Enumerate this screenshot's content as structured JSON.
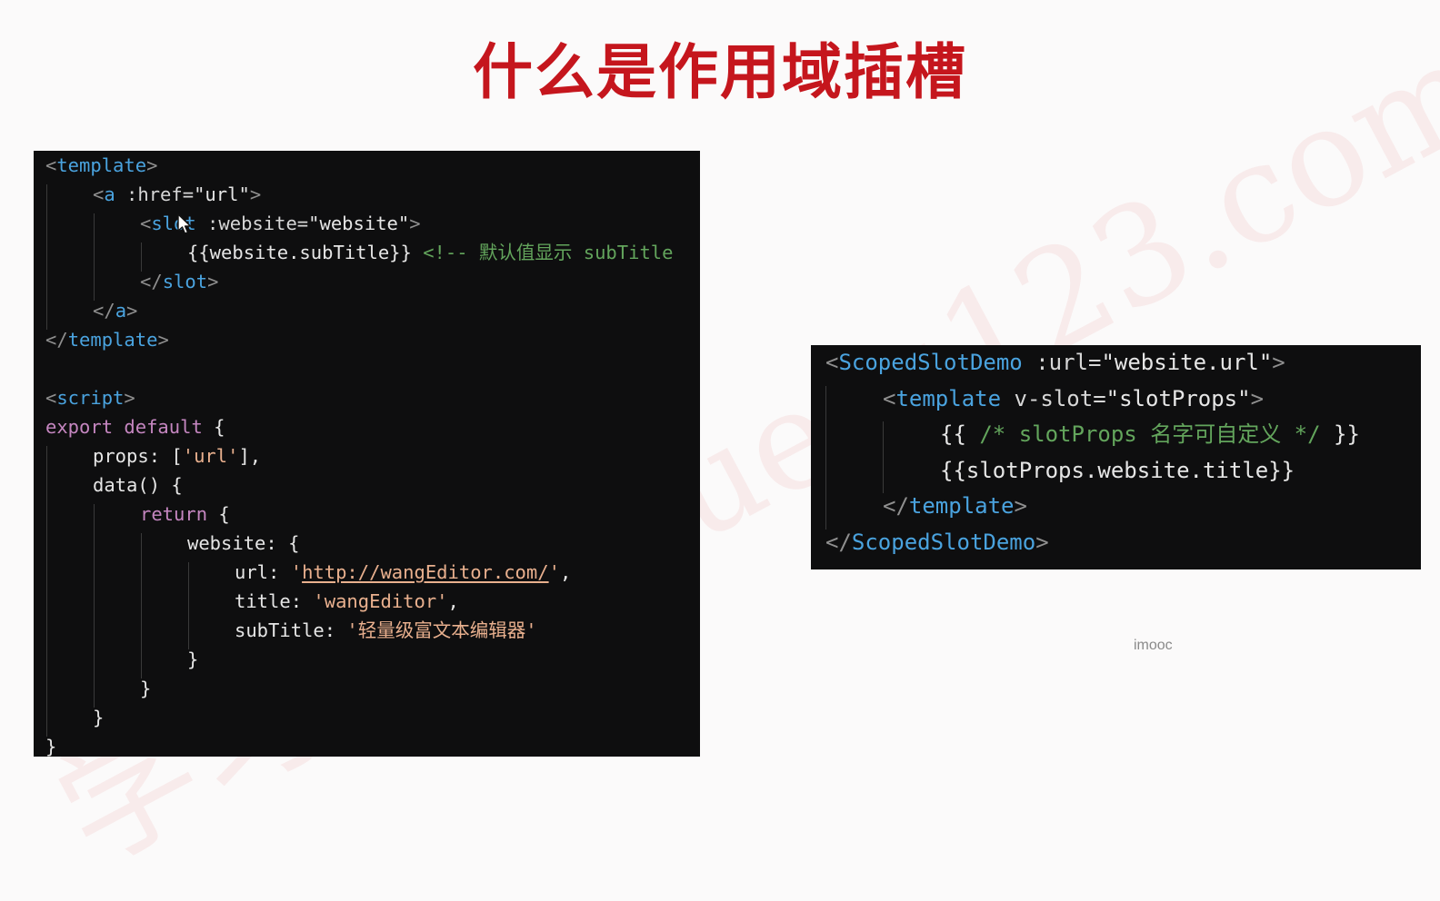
{
  "slide": {
    "title": "什么是作用域插槽",
    "watermark": "学习天优 Xuetu123.com",
    "imooc_label": "imooc"
  },
  "code_left": [
    {
      "indent": 0,
      "tokens": [
        {
          "t": "<",
          "c": "punct"
        },
        {
          "t": "template",
          "c": "tag"
        },
        {
          "t": ">",
          "c": "punct"
        }
      ]
    },
    {
      "indent": 1,
      "tokens": [
        {
          "t": "<",
          "c": "punct"
        },
        {
          "t": "a",
          "c": "tag"
        },
        {
          "t": " :href=",
          "c": "attr"
        },
        {
          "t": "\"url\"",
          "c": "text"
        },
        {
          "t": ">",
          "c": "punct"
        }
      ]
    },
    {
      "indent": 2,
      "tokens": [
        {
          "t": "<",
          "c": "punct"
        },
        {
          "t": "slot",
          "c": "tag"
        },
        {
          "t": " :website=",
          "c": "attr"
        },
        {
          "t": "\"website\"",
          "c": "text"
        },
        {
          "t": ">",
          "c": "punct"
        }
      ]
    },
    {
      "indent": 3,
      "tokens": [
        {
          "t": "{{website.subTitle}} ",
          "c": "text"
        },
        {
          "t": "<!-- 默认值显示 subTitle",
          "c": "comment"
        }
      ]
    },
    {
      "indent": 2,
      "tokens": [
        {
          "t": "</",
          "c": "punct"
        },
        {
          "t": "slot",
          "c": "tag"
        },
        {
          "t": ">",
          "c": "punct"
        }
      ]
    },
    {
      "indent": 1,
      "tokens": [
        {
          "t": "</",
          "c": "punct"
        },
        {
          "t": "a",
          "c": "tag"
        },
        {
          "t": ">",
          "c": "punct"
        }
      ]
    },
    {
      "indent": 0,
      "tokens": [
        {
          "t": "</",
          "c": "punct"
        },
        {
          "t": "template",
          "c": "tag"
        },
        {
          "t": ">",
          "c": "punct"
        }
      ]
    },
    {
      "indent": 0,
      "tokens": []
    },
    {
      "indent": 0,
      "tokens": [
        {
          "t": "<",
          "c": "punct"
        },
        {
          "t": "script",
          "c": "tag"
        },
        {
          "t": ">",
          "c": "punct"
        }
      ]
    },
    {
      "indent": 0,
      "tokens": [
        {
          "t": "export default",
          "c": "keyword"
        },
        {
          "t": " {",
          "c": "text"
        }
      ]
    },
    {
      "indent": 1,
      "tokens": [
        {
          "t": "props: [",
          "c": "text"
        },
        {
          "t": "'url'",
          "c": "string"
        },
        {
          "t": "],",
          "c": "text"
        }
      ]
    },
    {
      "indent": 1,
      "tokens": [
        {
          "t": "data() {",
          "c": "text"
        }
      ]
    },
    {
      "indent": 2,
      "tokens": [
        {
          "t": "return",
          "c": "keyword"
        },
        {
          "t": " {",
          "c": "text"
        }
      ]
    },
    {
      "indent": 3,
      "tokens": [
        {
          "t": "website: {",
          "c": "text"
        }
      ]
    },
    {
      "indent": 4,
      "tokens": [
        {
          "t": "url: ",
          "c": "text"
        },
        {
          "t": "'",
          "c": "string"
        },
        {
          "t": "http://wangEditor.com/",
          "c": "url"
        },
        {
          "t": "'",
          "c": "string"
        },
        {
          "t": ",",
          "c": "text"
        }
      ]
    },
    {
      "indent": 4,
      "tokens": [
        {
          "t": "title: ",
          "c": "text"
        },
        {
          "t": "'wangEditor'",
          "c": "string"
        },
        {
          "t": ",",
          "c": "text"
        }
      ]
    },
    {
      "indent": 4,
      "tokens": [
        {
          "t": "subTitle: ",
          "c": "text"
        },
        {
          "t": "'轻量级富文本编辑器'",
          "c": "string"
        }
      ]
    },
    {
      "indent": 3,
      "tokens": [
        {
          "t": "}",
          "c": "text"
        }
      ]
    },
    {
      "indent": 2,
      "tokens": [
        {
          "t": "}",
          "c": "text"
        }
      ]
    },
    {
      "indent": 1,
      "tokens": [
        {
          "t": "}",
          "c": "text"
        }
      ]
    },
    {
      "indent": 0,
      "tokens": [
        {
          "t": "}",
          "c": "text"
        }
      ]
    }
  ],
  "code_right": [
    {
      "indent": 0,
      "tokens": [
        {
          "t": "<",
          "c": "punct"
        },
        {
          "t": "ScopedSlotDemo",
          "c": "tag"
        },
        {
          "t": " :url=",
          "c": "attr"
        },
        {
          "t": "\"website.url\"",
          "c": "text"
        },
        {
          "t": ">",
          "c": "punct"
        }
      ]
    },
    {
      "indent": 1,
      "tokens": [
        {
          "t": "<",
          "c": "punct"
        },
        {
          "t": "template",
          "c": "tag"
        },
        {
          "t": " v-slot=",
          "c": "attr"
        },
        {
          "t": "\"slotProps\"",
          "c": "text"
        },
        {
          "t": ">",
          "c": "punct"
        }
      ]
    },
    {
      "indent": 2,
      "tokens": [
        {
          "t": "{{ ",
          "c": "text"
        },
        {
          "t": "/* slotProps 名字可自定义 */",
          "c": "comment"
        },
        {
          "t": " }}",
          "c": "text"
        }
      ]
    },
    {
      "indent": 2,
      "tokens": [
        {
          "t": "{{slotProps.website.title}}",
          "c": "text"
        }
      ]
    },
    {
      "indent": 1,
      "tokens": [
        {
          "t": "</",
          "c": "punct"
        },
        {
          "t": "template",
          "c": "tag"
        },
        {
          "t": ">",
          "c": "punct"
        }
      ]
    },
    {
      "indent": 0,
      "tokens": [
        {
          "t": "</",
          "c": "punct"
        },
        {
          "t": "ScopedSlotDemo",
          "c": "tag"
        },
        {
          "t": ">",
          "c": "punct"
        }
      ]
    }
  ],
  "colors": {
    "title": "#c5161d",
    "panel_bg": "#0e0e0f",
    "tag": "#4aa3df",
    "string": "#e9b08e",
    "comment": "#63a55c",
    "keyword": "#c586c0"
  },
  "icons": {
    "cursor": "mouse-pointer-icon"
  }
}
